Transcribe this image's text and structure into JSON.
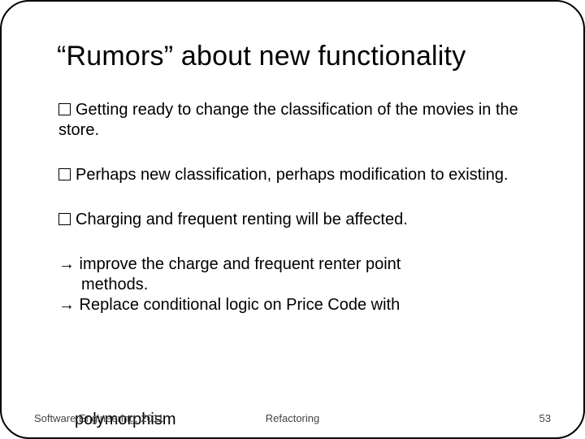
{
  "title": "“Rumors” about new functionality",
  "bullets": [
    "Getting ready to change the classification of the movies in the store.",
    "Perhaps new classification, perhaps modification to existing.",
    "Charging and frequent renting will be affected."
  ],
  "arrow1_line1": "→ improve the charge and frequent renter point",
  "arrow1_line2": "methods.",
  "arrow2": "→ Replace conditional logic on Price Code with",
  "poly": "polymorphism",
  "footer": {
    "left": "Software Engineering, 2011",
    "center": "Refactoring",
    "right": "53"
  }
}
